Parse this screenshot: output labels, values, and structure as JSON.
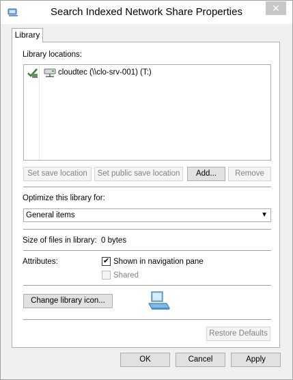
{
  "window": {
    "title": "Search Indexed Network Share Properties",
    "close_glyph": "✕"
  },
  "tabs": [
    {
      "label": "Library"
    }
  ],
  "library_locations": {
    "label": "Library locations:",
    "items": [
      {
        "text": "cloudtec (\\\\clo-srv-001) (T:)",
        "icon": "network-drive-icon",
        "default_marker_icon": "green-check-save-location-icon"
      }
    ]
  },
  "location_buttons": {
    "set_save": "Set save location",
    "set_public_save": "Set public save location",
    "add": "Add...",
    "remove": "Remove"
  },
  "optimize": {
    "label": "Optimize this library for:",
    "selected": "General items"
  },
  "size": {
    "label": "Size of files in library:",
    "value": "0 bytes"
  },
  "attributes": {
    "label": "Attributes:",
    "shown_in_nav": {
      "label": "Shown in navigation pane",
      "checked": true
    },
    "shared": {
      "label": "Shared",
      "checked": false,
      "disabled": true
    }
  },
  "library_icon": {
    "change_button": "Change library icon...",
    "preview_icon": "library-computer-icon"
  },
  "restore_defaults": "Restore Defaults",
  "footer": {
    "ok": "OK",
    "cancel": "Cancel",
    "apply": "Apply"
  },
  "colors": {
    "window_bg": "#f0f0f0",
    "panel_bg": "#ffffff",
    "close_button": "#c7c7c7",
    "disabled_text": "#838383"
  }
}
